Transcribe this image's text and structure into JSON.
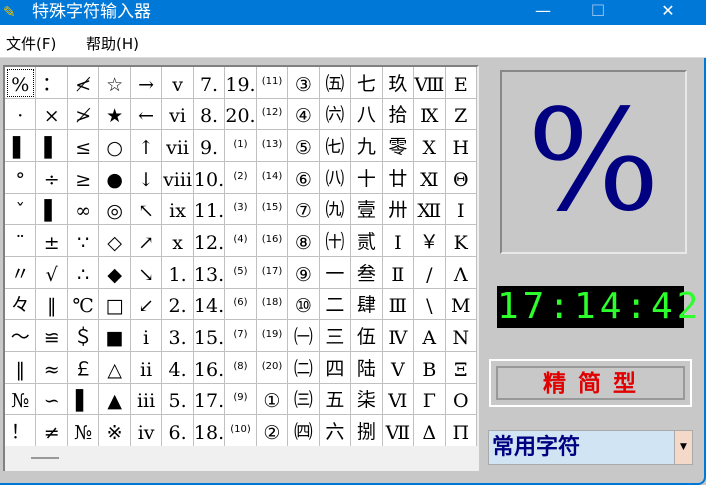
{
  "window": {
    "title": "特殊字符输入器",
    "minimize": "—",
    "maximize": "☐",
    "close": "✕"
  },
  "menu": [
    "文件(F)",
    "帮助(H)"
  ],
  "grid_columns": [
    [
      "%",
      "·",
      "▌",
      "°",
      "ˇ",
      "¨",
      "〃",
      "々",
      "～",
      "‖",
      "№",
      "！"
    ],
    [
      "：",
      "×",
      "▌",
      "÷",
      "▌",
      "±",
      "√",
      "‖",
      "≌",
      "≈",
      "∽",
      "≠"
    ],
    [
      "≮",
      "≯",
      "≤",
      "≥",
      "∞",
      "∵",
      "∴",
      "℃",
      "＄",
      "￡",
      "▌",
      "№"
    ],
    [
      "☆",
      "★",
      "○",
      "●",
      "◎",
      "◇",
      "◆",
      "□",
      "■",
      "△",
      "▲",
      "※"
    ],
    [
      "→",
      "←",
      "↑",
      "↓",
      "↖",
      "↗",
      "↘",
      "↙",
      "i",
      "ii",
      "iii",
      "iv"
    ],
    [
      "v",
      "vi",
      "vii",
      "viii",
      "ix",
      "x",
      "1.",
      "2.",
      "3.",
      "4.",
      "5.",
      "6."
    ],
    [
      "7.",
      "8.",
      "9.",
      "10.",
      "11.",
      "12.",
      "13.",
      "14.",
      "15.",
      "16.",
      "17.",
      "18."
    ],
    [
      "19.",
      "20.",
      "(1)",
      "(2)",
      "(3)",
      "(4)",
      "(5)",
      "(6)",
      "(7)",
      "(8)",
      "(9)",
      "(10)"
    ],
    [
      "(11)",
      "(12)",
      "(13)",
      "(14)",
      "(15)",
      "(16)",
      "(17)",
      "(18)",
      "(19)",
      "(20)",
      "①",
      "②"
    ],
    [
      "③",
      "④",
      "⑤",
      "⑥",
      "⑦",
      "⑧",
      "⑨",
      "⑩",
      "㈠",
      "㈡",
      "㈢",
      "㈣"
    ],
    [
      "㈤",
      "㈥",
      "㈦",
      "㈧",
      "㈨",
      "㈩",
      "一",
      "二",
      "三",
      "四",
      "五",
      "六"
    ],
    [
      "七",
      "八",
      "九",
      "十",
      "壹",
      "贰",
      "叁",
      "肆",
      "伍",
      "陆",
      "柒",
      "捌"
    ],
    [
      "玖",
      "拾",
      "零",
      "廿",
      "卅",
      "Ⅰ",
      "Ⅱ",
      "Ⅲ",
      "Ⅳ",
      "Ⅴ",
      "Ⅵ",
      "Ⅶ"
    ],
    [
      "Ⅷ",
      "Ⅸ",
      "Ⅹ",
      "Ⅺ",
      "Ⅻ",
      "￥",
      "/",
      "\\",
      "Α",
      "Β",
      "Γ",
      "Δ"
    ],
    [
      "Ε",
      "Ζ",
      "Η",
      "Θ",
      "Ι",
      "Κ",
      "Λ",
      "Μ",
      "Ν",
      "Ξ",
      "Ο",
      "Π"
    ]
  ],
  "selected_char": "%",
  "preview": {
    "char": "%"
  },
  "clock": "17:14:42",
  "mode_button": "精 简 型",
  "category_dropdown": {
    "value": "常用字符",
    "arrow": "▼"
  }
}
